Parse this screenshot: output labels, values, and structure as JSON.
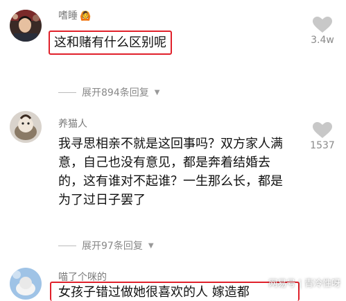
{
  "comments": [
    {
      "username": "嗜睡",
      "badge_icon": "girl-emoji-icon",
      "text": "这和赌有什么区别呢",
      "like_count": "3.4w",
      "replies_label": "展开894条回复"
    },
    {
      "username": "养猫人",
      "text": "我寻思相亲不就是这回事吗？双方家人满意，自己也没有意见，都是奔着结婚去的，这有谁对不起谁？一生那么长，都是为了过日子罢了",
      "text_lines": [
        "我寻思相亲不就是这回事吗？双方家人满",
        "意，自己也没有意见，都是奔着结婚去",
        "的，这有谁对不起谁？一生那么长，都是",
        "为了过日子罢了"
      ],
      "like_count": "1537",
      "replies_label": "展开97条回复"
    },
    {
      "username": "喵了个咪的",
      "text_partial": "女孩子错过做她很喜欢的人 嫁造都"
    }
  ],
  "watermark": "网易号 | 青冷性呀",
  "colors": {
    "highlight_box": "#e0202a",
    "username": "#7a7a7a",
    "meta": "#888888",
    "like_icon": "#c8c8c8"
  }
}
